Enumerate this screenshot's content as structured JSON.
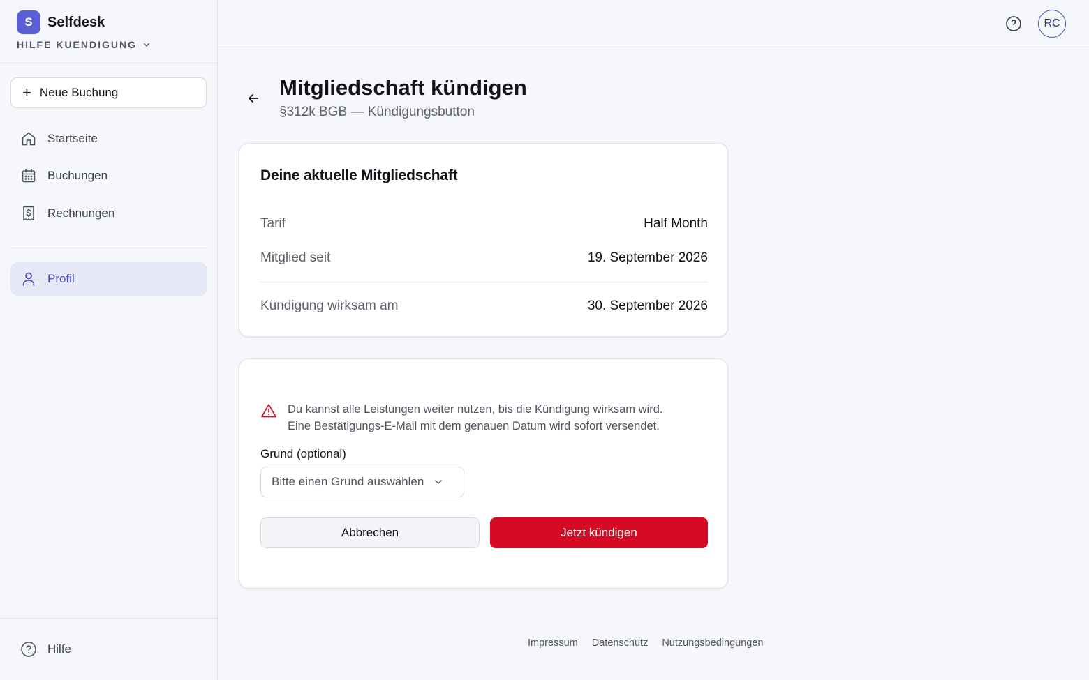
{
  "app": {
    "name": "Selfdesk",
    "logo_letter": "S",
    "workspace": "HILFE KUENDIGUNG"
  },
  "sidebar": {
    "new_booking": "Neue Buchung",
    "items": [
      {
        "label": "Startseite",
        "icon": "home-icon"
      },
      {
        "label": "Buchungen",
        "icon": "calendar-icon"
      },
      {
        "label": "Rechnungen",
        "icon": "invoice-icon"
      },
      {
        "label": "Profil",
        "icon": "user-icon",
        "active": true
      }
    ],
    "help": "Hilfe"
  },
  "topbar": {
    "avatar_initials": "RC"
  },
  "header": {
    "title": "Mitgliedschaft kündigen",
    "subtitle": "§312k BGB — Kündigungsbutton"
  },
  "membership": {
    "title": "Deine aktuelle Mitgliedschaft",
    "tariff_label": "Tarif",
    "tariff_value": "Half Month",
    "since_label": "Mitglied seit",
    "since_value": "19. September 2026",
    "effective_label": "Kündigung wirksam am",
    "effective_value": "30. September 2026"
  },
  "cancellation": {
    "warning_line1": "Du kannst alle Leistungen weiter nutzen, bis die Kündigung wirksam wird.",
    "warning_line2": "Eine Bestätigungs-E-Mail mit dem genauen Datum wird sofort versendet.",
    "reason_label": "Grund (optional)",
    "reason_placeholder": "Bitte einen Grund auswählen",
    "cancel_button": "Abbrechen",
    "confirm_button": "Jetzt kündigen"
  },
  "footer": {
    "links": [
      "Impressum",
      "Datenschutz",
      "Nutzungsbedingungen"
    ]
  },
  "colors": {
    "accent": "#5a5fd6",
    "danger": "#d60a22",
    "active_bg": "#e7e8f6"
  }
}
